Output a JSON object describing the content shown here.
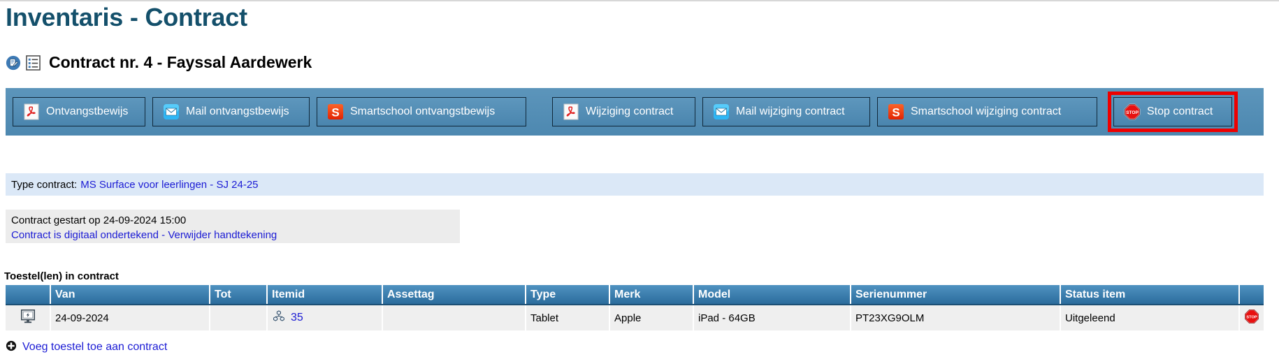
{
  "page": {
    "title": "Inventaris - Contract"
  },
  "contract_header": {
    "title": "Contract nr. 4 - Fayssal Aardewerk",
    "edit_icon": "edit-document-icon",
    "list_icon": "list-document-icon"
  },
  "toolbar": {
    "buttons": [
      {
        "label": "Ontvangstbewijs",
        "icon": "pdf-icon",
        "highlighted": false
      },
      {
        "label": "Mail ontvangstbewijs",
        "icon": "mail-icon",
        "highlighted": false
      },
      {
        "label": "Smartschool ontvangstbewijs",
        "icon": "smartschool-icon",
        "highlighted": false
      },
      {
        "label": "Wijziging contract",
        "icon": "pdf-icon",
        "highlighted": false
      },
      {
        "label": "Mail wijziging contract",
        "icon": "mail-icon",
        "highlighted": false
      },
      {
        "label": "Smartschool wijziging contract",
        "icon": "smartschool-icon",
        "highlighted": false
      },
      {
        "label": "Stop contract",
        "icon": "stop-icon",
        "highlighted": true
      }
    ]
  },
  "type_contract": {
    "label": "Type contract:",
    "value": "MS Surface voor leerlingen - SJ 24-25"
  },
  "contract_status": {
    "started_line": "Contract gestart op 24-09-2024 15:00",
    "signed_text": "Contract is digitaal ondertekend",
    "separator": " - ",
    "remove_signature_link": "Verwijder handtekening"
  },
  "devices": {
    "section_label": "Toestel(len) in contract",
    "columns": [
      "",
      "Van",
      "Tot",
      "Itemid",
      "Assettag",
      "Type",
      "Merk",
      "Model",
      "Serienummer",
      "Status item",
      ""
    ],
    "rows": [
      {
        "device_icon": "monitor-icon",
        "van": "24-09-2024",
        "tot": "",
        "itemid_icon": "cluster-icon",
        "itemid": "35",
        "assettag": "",
        "type": "Tablet",
        "merk": "Apple",
        "model": "iPad - 64GB",
        "serienummer": "PT23XG9OLM",
        "status_item": "Uitgeleend",
        "action_icon": "stop-icon"
      }
    ],
    "add_link": "Voeg toestel toe aan contract",
    "add_icon": "plus-circle-icon"
  },
  "colors": {
    "title_blue": "#14506b",
    "toolbar_blue": "#4d88b0",
    "link_blue": "#1b1bd4",
    "header_blue": "#2b6c9c",
    "type_band": "#dbe8f7",
    "status_band": "#ececec",
    "highlight_red": "#ee0000"
  }
}
